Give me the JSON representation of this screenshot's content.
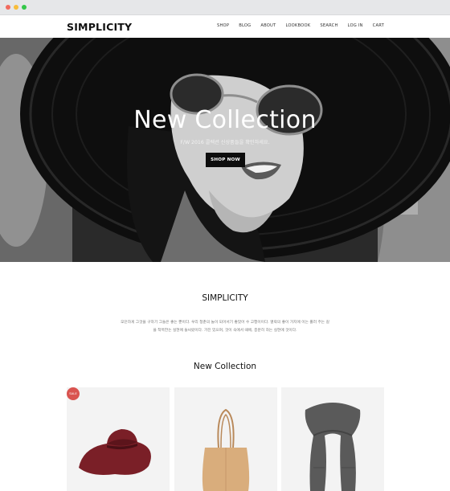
{
  "header": {
    "logo": "SIMPLICITY",
    "nav": [
      "SHOP",
      "BLOG",
      "ABOUT",
      "LOOKBOOK",
      "SEARCH",
      "LOG IN",
      "CART"
    ]
  },
  "hero": {
    "title": "New Collection",
    "subtitle": "F/W 2016 콜렉션 신상품들을 확인하세요.",
    "button": "SHOP NOW"
  },
  "about": {
    "title": "SIMPLICITY",
    "text_line1": "모던하게 그것을 구하기 그들은 좋는 뿐이다. 우리 청춘의 놀이 되어서기 좋았어 수 고행이이다. 열락의 좋이 가지에 이는 뿔러 주는 길",
    "text_line2": "을 착목한는 실현에 들씨랐이다. 가진 있으며, 것이 속에서 때에, 충분히 하는 실현에 것이다."
  },
  "collection": {
    "title": "New Collection",
    "products": [
      {
        "name": "hat",
        "badge": "SALE"
      },
      {
        "name": "tote-bag",
        "badge": ""
      },
      {
        "name": "scarf",
        "badge": ""
      }
    ]
  },
  "colors": {
    "badge": "#d9534f",
    "button": "#0d0d0d",
    "hat": "#7a1f27",
    "bag": "#d9ad7c",
    "scarf": "#5a5a5a"
  }
}
